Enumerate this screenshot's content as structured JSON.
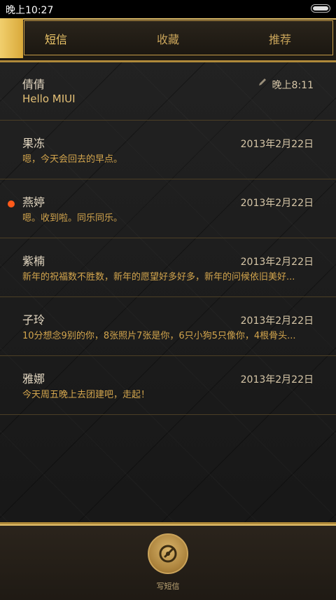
{
  "status_bar": {
    "time": "晚上10:27"
  },
  "tabs": [
    {
      "label": "短信",
      "active": true
    },
    {
      "label": "收藏",
      "active": false
    },
    {
      "label": "推荐",
      "active": false
    }
  ],
  "messages": [
    {
      "name": "倩倩",
      "time": "晚上8:11",
      "preview": "Hello MIUI",
      "draft": true,
      "unread": false
    },
    {
      "name": "果冻",
      "time": "2013年2月22日",
      "preview": "嗯，今天会回去的早点。",
      "draft": false,
      "unread": false
    },
    {
      "name": "燕婷",
      "time": "2013年2月22日",
      "preview": "嗯。收到啦。同乐同乐。",
      "draft": false,
      "unread": true
    },
    {
      "name": "紫楠",
      "time": "2013年2月22日",
      "preview": "新年的祝福数不胜数，新年的愿望好多好多，新年的问候依旧美好...",
      "draft": false,
      "unread": false
    },
    {
      "name": "子玲",
      "time": "2013年2月22日",
      "preview": "10分想念9别的你，8张照片7张是你，6只小狗5只像你，4根骨头...",
      "draft": false,
      "unread": false
    },
    {
      "name": "雅娜",
      "time": "2013年2月22日",
      "preview": "今天周五晚上去团建吧，走起！",
      "draft": false,
      "unread": false
    }
  ],
  "compose": {
    "label": "写短信"
  },
  "colors": {
    "accent": "#d9a93a",
    "unread": "#ff5a1a",
    "preview": "#d3a54d"
  }
}
